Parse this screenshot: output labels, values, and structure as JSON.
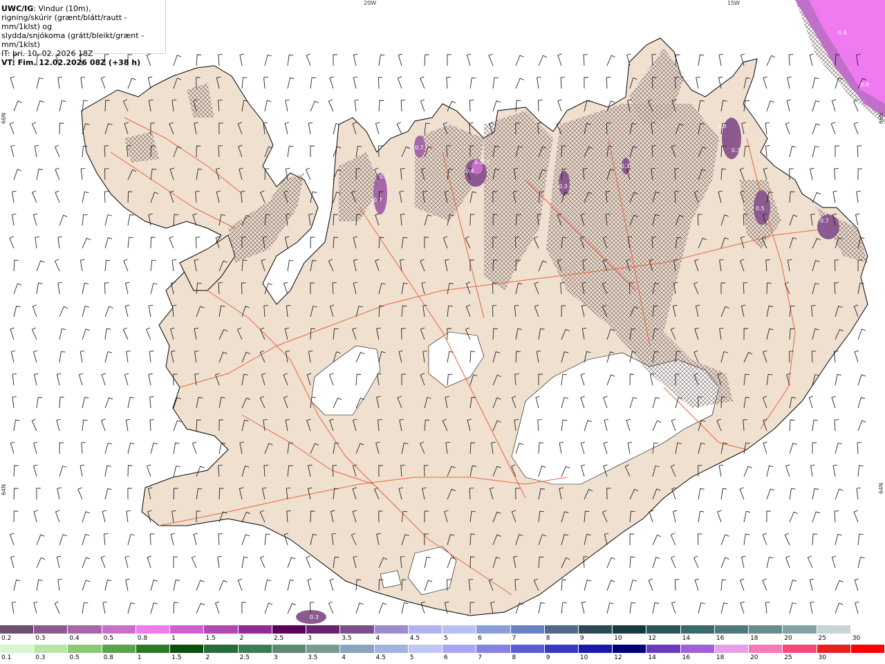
{
  "header": {
    "product": "UWC/IG",
    "line1_rest": ": Vindur (10m),",
    "line2": "rigning/skúrir (grænt/blátt/rautt - mm/1klst) og",
    "line3": "slydda/snjókoma (grátt/bleikt/grænt - mm/1klst)",
    "line4": "IT: þri. 10. 02. 2026 18Z",
    "line5": "VT: Fim. 12.02.2026 08Z (+38 h)"
  },
  "grid_labels": {
    "lon_20w": "20W",
    "lon_15w": "15W",
    "lat_66n_left": "66N",
    "lat_64n_left": "64N",
    "lat_66n_right": "66N",
    "lat_64n_right": "64N"
  },
  "precip_labels": [
    "0.8",
    "0.9",
    "0.3",
    "0.3",
    "0.5",
    "0.7",
    "0.3",
    "0.3",
    "0.7",
    "0.7",
    "0.7",
    "0.4",
    "0.5",
    "0.7",
    "0.3"
  ],
  "legend_snow": {
    "ticks": [
      "0.2",
      "0.3",
      "0.4",
      "0.5",
      "0.8",
      "1",
      "1.5",
      "2",
      "2.5",
      "3",
      "3.5",
      "4",
      "4.5",
      "5",
      "6",
      "7",
      "8",
      "9",
      "10",
      "12",
      "14",
      "16",
      "18",
      "20",
      "25",
      "30"
    ],
    "colors": [
      "#6d4e6e",
      "#8c5a8e",
      "#a666a8",
      "#c870c8",
      "#f07af0",
      "#d060d0",
      "#b048b0",
      "#902c90",
      "#5a005a",
      "#6a226a",
      "#7a4f8a",
      "#9b8ccc",
      "#b3b3f2",
      "#b6c2ee",
      "#8a9fd8",
      "#6a83c0",
      "#50688c",
      "#2e4a5a",
      "#183a40",
      "#2a5656",
      "#3a6a6a",
      "#4f7a7a",
      "#688c8c",
      "#84a2a2",
      "#c8d4d4",
      "#ffffff"
    ]
  },
  "legend_rain": {
    "ticks": [
      "0.1",
      "0.3",
      "0.5",
      "0.8",
      "1",
      "1.5",
      "2",
      "2.5",
      "3",
      "3.5",
      "4",
      "4.5",
      "5",
      "6",
      "7",
      "8",
      "9",
      "10",
      "12",
      "14",
      "16",
      "18",
      "20",
      "25",
      "30"
    ],
    "colors": [
      "#d8f5d0",
      "#b8e6a8",
      "#8cc878",
      "#5aa24e",
      "#2a7a2a",
      "#0e4e0e",
      "#2a6a3a",
      "#3e7a55",
      "#5b8a6e",
      "#7a9a90",
      "#8aa4c0",
      "#a2b4dc",
      "#c0c6f2",
      "#a8a8ee",
      "#8484e0",
      "#5c5cd2",
      "#3838c0",
      "#1a1aa8",
      "#00007a",
      "#6a3ab8",
      "#a060d8",
      "#e6a0e6",
      "#f47ab8",
      "#f04a7a",
      "#e82020",
      "#ff0000"
    ]
  },
  "colors": {
    "land": "#f0e0d0",
    "glacier": "#ffffff",
    "roads": "#e8643c",
    "coast": "#000000",
    "hatch": "#7a6a6a"
  }
}
